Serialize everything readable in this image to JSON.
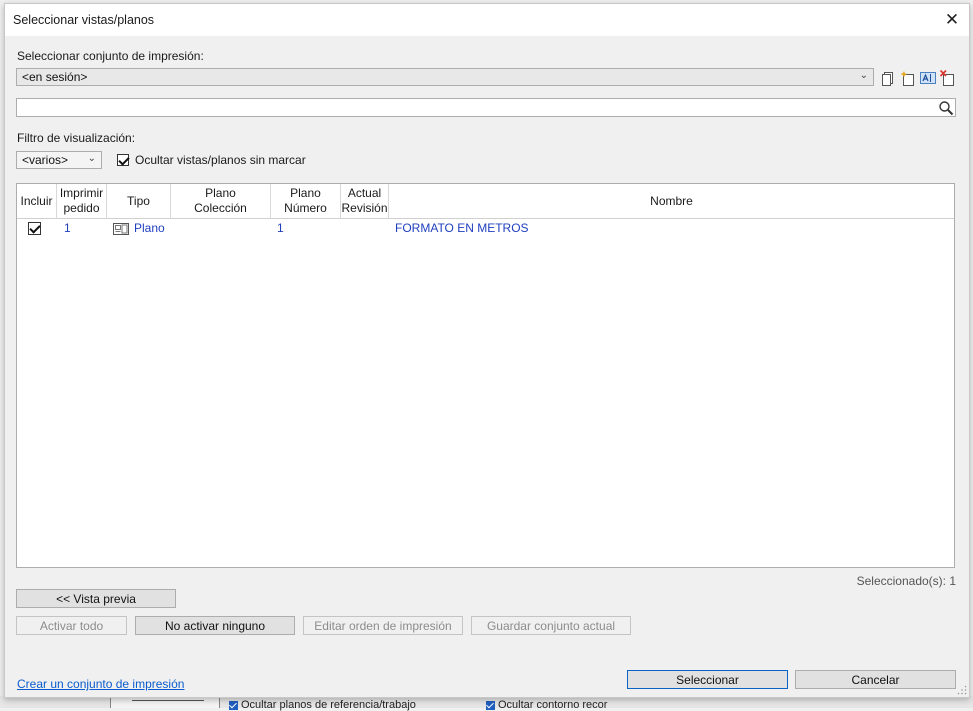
{
  "background": {
    "hide_ref_planes": "Ocultar planos de referencia/trabajo",
    "hide_crop_outline": "Ocultar contorno recor"
  },
  "dialog": {
    "title": "Seleccionar vistas/planos",
    "close_glyph": "✕"
  },
  "print_set": {
    "label": "Seleccionar conjunto de impresión:",
    "selected": "<en sesión>"
  },
  "search": {
    "value": "",
    "placeholder": ""
  },
  "filter": {
    "label": "Filtro de visualización:",
    "selected": "<varios>",
    "hide_unchecked_label": "Ocultar vistas/planos sin marcar",
    "hide_unchecked": true
  },
  "table": {
    "columns": [
      {
        "label": "Incluir"
      },
      {
        "label": "Imprimir pedido"
      },
      {
        "label": "Tipo"
      },
      {
        "label": "Plano Colección"
      },
      {
        "label": "Plano Número"
      },
      {
        "label": "Actual Revisión"
      },
      {
        "label": "Nombre"
      }
    ],
    "column_lines": [
      [
        "Incluir"
      ],
      [
        "Imprimir",
        "pedido"
      ],
      [
        "Tipo"
      ],
      [
        "Plano",
        "Colección"
      ],
      [
        "Plano",
        "Número"
      ],
      [
        "Actual",
        "Revisión"
      ],
      [
        "Nombre"
      ]
    ],
    "rows": [
      {
        "include": true,
        "order": "1",
        "type": "Plano",
        "collection": "",
        "number": "1",
        "revision": "",
        "name": "FORMATO EN METROS"
      }
    ]
  },
  "selected_count": "Seleccionado(s): 1",
  "buttons": {
    "preview": "<< Vista previa",
    "check_all": "Activar todo",
    "check_none": "No activar ninguno",
    "edit_order": "Editar orden de impresión",
    "save_set": "Guardar conjunto actual",
    "select": "Seleccionar",
    "cancel": "Cancelar"
  },
  "create_set_link": "Crear un conjunto de impresión",
  "colors": {
    "link": "#0b5ccc",
    "row_text": "#1f3fbf",
    "default_button_border": "#0a64c8"
  }
}
